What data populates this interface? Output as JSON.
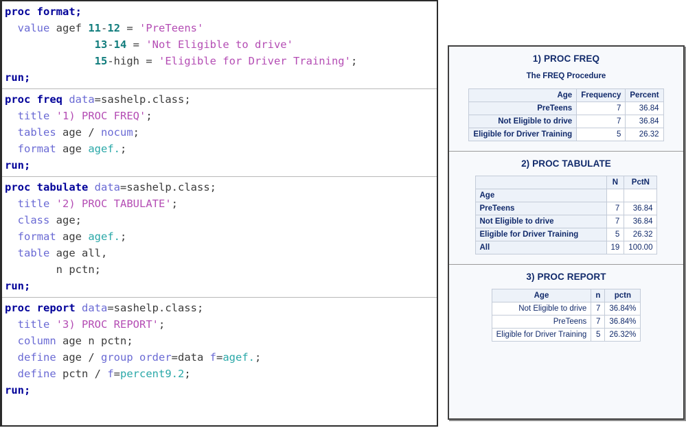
{
  "code_panel": {
    "blocks": [
      {
        "id": "proc-format",
        "lines": [
          [
            {
              "t": "proc format;",
              "c": "kw"
            }
          ],
          [
            {
              "t": "  ",
              "c": "plain"
            },
            {
              "t": "value",
              "c": "stmt"
            },
            {
              "t": " agef ",
              "c": "plain"
            },
            {
              "t": "11",
              "c": "num"
            },
            {
              "t": "-",
              "c": "plain"
            },
            {
              "t": "12",
              "c": "num"
            },
            {
              "t": " = ",
              "c": "plain"
            },
            {
              "t": "'PreTeens'",
              "c": "str"
            }
          ],
          [
            {
              "t": "              ",
              "c": "plain"
            },
            {
              "t": "13",
              "c": "num"
            },
            {
              "t": "-",
              "c": "plain"
            },
            {
              "t": "14",
              "c": "num"
            },
            {
              "t": " = ",
              "c": "plain"
            },
            {
              "t": "'Not Eligible to drive'",
              "c": "str"
            }
          ],
          [
            {
              "t": "              ",
              "c": "plain"
            },
            {
              "t": "15",
              "c": "num"
            },
            {
              "t": "-high = ",
              "c": "plain"
            },
            {
              "t": "'Eligible for Driver Training'",
              "c": "str"
            },
            {
              "t": ";",
              "c": "plain"
            }
          ],
          [
            {
              "t": "run;",
              "c": "kw"
            }
          ]
        ]
      },
      {
        "id": "proc-freq",
        "lines": [
          [
            {
              "t": "proc freq",
              "c": "kw"
            },
            {
              "t": " ",
              "c": "plain"
            },
            {
              "t": "data",
              "c": "stmt"
            },
            {
              "t": "=sashelp.class;",
              "c": "plain"
            }
          ],
          [
            {
              "t": "  ",
              "c": "plain"
            },
            {
              "t": "title",
              "c": "stmt"
            },
            {
              "t": " ",
              "c": "plain"
            },
            {
              "t": "'1) PROC FREQ'",
              "c": "str"
            },
            {
              "t": ";",
              "c": "plain"
            }
          ],
          [
            {
              "t": "  ",
              "c": "plain"
            },
            {
              "t": "tables",
              "c": "stmt"
            },
            {
              "t": " age / ",
              "c": "plain"
            },
            {
              "t": "nocum",
              "c": "stmt"
            },
            {
              "t": ";",
              "c": "plain"
            }
          ],
          [
            {
              "t": "  ",
              "c": "plain"
            },
            {
              "t": "format",
              "c": "stmt"
            },
            {
              "t": " age ",
              "c": "plain"
            },
            {
              "t": "agef.",
              "c": "fmt"
            },
            {
              "t": ";",
              "c": "plain"
            }
          ],
          [
            {
              "t": "run;",
              "c": "kw"
            }
          ]
        ]
      },
      {
        "id": "proc-tabulate",
        "lines": [
          [
            {
              "t": "proc tabulate",
              "c": "kw"
            },
            {
              "t": " ",
              "c": "plain"
            },
            {
              "t": "data",
              "c": "stmt"
            },
            {
              "t": "=sashelp.class;",
              "c": "plain"
            }
          ],
          [
            {
              "t": "  ",
              "c": "plain"
            },
            {
              "t": "title",
              "c": "stmt"
            },
            {
              "t": " ",
              "c": "plain"
            },
            {
              "t": "'2) PROC TABULATE'",
              "c": "str"
            },
            {
              "t": ";",
              "c": "plain"
            }
          ],
          [
            {
              "t": "  ",
              "c": "plain"
            },
            {
              "t": "class",
              "c": "stmt"
            },
            {
              "t": " age;",
              "c": "plain"
            }
          ],
          [
            {
              "t": "  ",
              "c": "plain"
            },
            {
              "t": "format",
              "c": "stmt"
            },
            {
              "t": " age ",
              "c": "plain"
            },
            {
              "t": "agef.",
              "c": "fmt"
            },
            {
              "t": ";",
              "c": "plain"
            }
          ],
          [
            {
              "t": "  ",
              "c": "plain"
            },
            {
              "t": "table",
              "c": "stmt"
            },
            {
              "t": " age all,",
              "c": "plain"
            }
          ],
          [
            {
              "t": "        n pctn;",
              "c": "plain"
            }
          ],
          [
            {
              "t": "run;",
              "c": "kw"
            }
          ]
        ]
      },
      {
        "id": "proc-report",
        "lines": [
          [
            {
              "t": "proc report",
              "c": "kw"
            },
            {
              "t": " ",
              "c": "plain"
            },
            {
              "t": "data",
              "c": "stmt"
            },
            {
              "t": "=sashelp.class;",
              "c": "plain"
            }
          ],
          [
            {
              "t": "  ",
              "c": "plain"
            },
            {
              "t": "title",
              "c": "stmt"
            },
            {
              "t": " ",
              "c": "plain"
            },
            {
              "t": "'3) PROC REPORT'",
              "c": "str"
            },
            {
              "t": ";",
              "c": "plain"
            }
          ],
          [
            {
              "t": "  ",
              "c": "plain"
            },
            {
              "t": "column",
              "c": "stmt"
            },
            {
              "t": " age n pctn;",
              "c": "plain"
            }
          ],
          [
            {
              "t": "  ",
              "c": "plain"
            },
            {
              "t": "define",
              "c": "stmt"
            },
            {
              "t": " age / ",
              "c": "plain"
            },
            {
              "t": "group order",
              "c": "stmt"
            },
            {
              "t": "=data ",
              "c": "plain"
            },
            {
              "t": "f",
              "c": "stmt"
            },
            {
              "t": "=",
              "c": "plain"
            },
            {
              "t": "agef.",
              "c": "fmt"
            },
            {
              "t": ";",
              "c": "plain"
            }
          ],
          [
            {
              "t": "  ",
              "c": "plain"
            },
            {
              "t": "define",
              "c": "stmt"
            },
            {
              "t": " pctn / ",
              "c": "plain"
            },
            {
              "t": "f",
              "c": "stmt"
            },
            {
              "t": "=",
              "c": "plain"
            },
            {
              "t": "percent9.2",
              "c": "fmt"
            },
            {
              "t": ";",
              "c": "plain"
            }
          ],
          [
            {
              "t": "run;",
              "c": "kw"
            }
          ]
        ]
      }
    ]
  },
  "output_panel": {
    "freq": {
      "title": "1) PROC FREQ",
      "subtitle": "The FREQ Procedure",
      "headers": [
        "Age",
        "Frequency",
        "Percent"
      ],
      "rows": [
        [
          "PreTeens",
          "7",
          "36.84"
        ],
        [
          "Not Eligible to drive",
          "7",
          "36.84"
        ],
        [
          "Eligible for Driver Training",
          "5",
          "26.32"
        ]
      ]
    },
    "tabulate": {
      "title": "2) PROC TABULATE",
      "headers": [
        "",
        "N",
        "PctN"
      ],
      "stub_label": "Age",
      "rows": [
        [
          "PreTeens",
          "7",
          "36.84"
        ],
        [
          "Not Eligible to drive",
          "7",
          "36.84"
        ],
        [
          "Eligible for Driver Training",
          "5",
          "26.32"
        ],
        [
          "All",
          "19",
          "100.00"
        ]
      ]
    },
    "report": {
      "title": "3) PROC REPORT",
      "headers": [
        "Age",
        "n",
        "pctn"
      ],
      "rows": [
        [
          "Not Eligible to drive",
          "7",
          "36.84%"
        ],
        [
          "PreTeens",
          "7",
          "36.84%"
        ],
        [
          "Eligible for Driver Training",
          "5",
          "26.32%"
        ]
      ]
    }
  }
}
